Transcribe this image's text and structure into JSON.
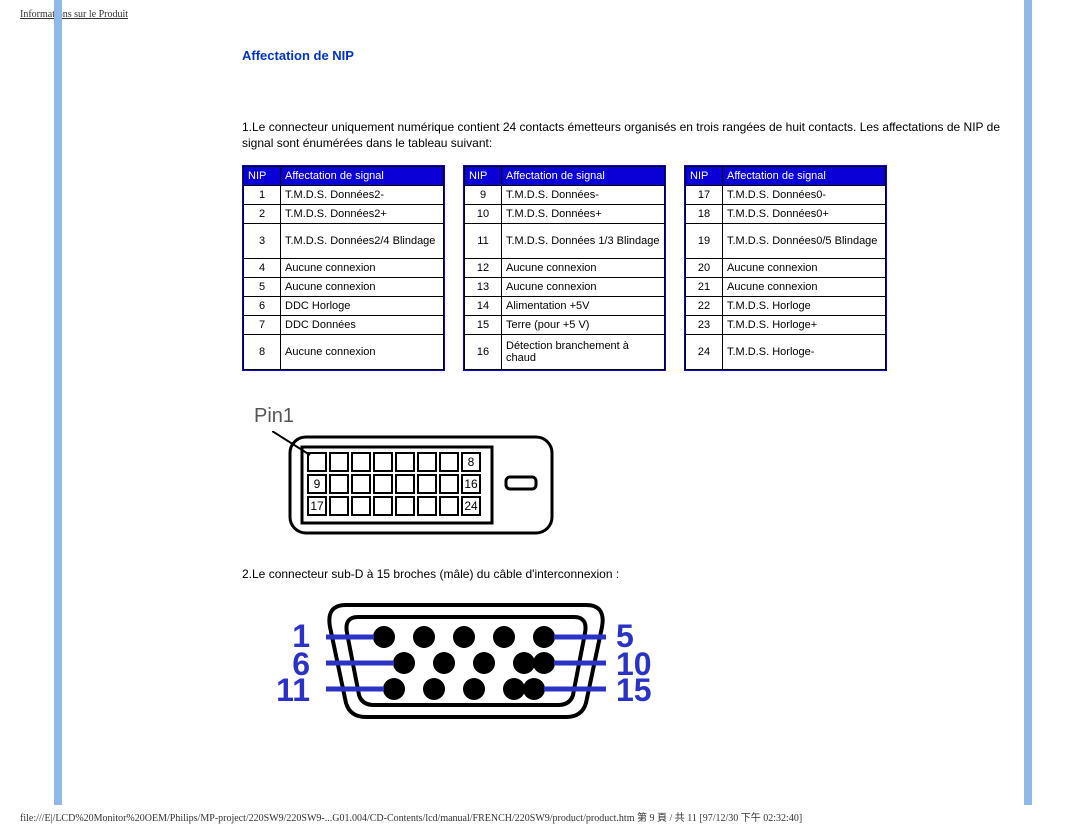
{
  "header": {
    "title": "Informations sur le Produit"
  },
  "section": {
    "title": "Affectation de NIP",
    "para1": "1.Le connecteur uniquement numérique contient 24 contacts émetteurs organisés en trois rangées de huit contacts. Les affectations de NIP de signal sont énumérées dans le tableau suivant:",
    "para2": "2.Le connecteur sub-D à 15 broches (mâle) du câble d'interconnexion :"
  },
  "table_headers": {
    "nip": "NIP",
    "sig": "Affectation de signal"
  },
  "pins_a": [
    {
      "n": "1",
      "s": "T.M.D.S. Données2-"
    },
    {
      "n": "2",
      "s": "T.M.D.S. Données2+"
    },
    {
      "n": "3",
      "s": "T.M.D.S. Données2/4 Blindage"
    },
    {
      "n": "4",
      "s": "Aucune connexion"
    },
    {
      "n": "5",
      "s": "Aucune connexion"
    },
    {
      "n": "6",
      "s": "DDC Horloge"
    },
    {
      "n": "7",
      "s": "DDC Données"
    },
    {
      "n": "8",
      "s": "Aucune connexion"
    }
  ],
  "pins_b": [
    {
      "n": "9",
      "s": "T.M.D.S. Données-"
    },
    {
      "n": "10",
      "s": "T.M.D.S. Données+"
    },
    {
      "n": "11",
      "s": "T.M.D.S. Données 1/3 Blindage"
    },
    {
      "n": "12",
      "s": "Aucune connexion"
    },
    {
      "n": "13",
      "s": "Aucune connexion"
    },
    {
      "n": "14",
      "s": "Alimentation +5V"
    },
    {
      "n": "15",
      "s": "Terre (pour +5 V)"
    },
    {
      "n": "16",
      "s": "Détection branchement à chaud"
    }
  ],
  "pins_c": [
    {
      "n": "17",
      "s": "T.M.D.S. Données0-"
    },
    {
      "n": "18",
      "s": "T.M.D.S. Données0+"
    },
    {
      "n": "19",
      "s": "T.M.D.S. Données0/5 Blindage"
    },
    {
      "n": "20",
      "s": "Aucune connexion"
    },
    {
      "n": "21",
      "s": "Aucune connexion"
    },
    {
      "n": "22",
      "s": "T.M.D.S. Horloge"
    },
    {
      "n": "23",
      "s": "T.M.D.S. Horloge+"
    },
    {
      "n": "24",
      "s": "T.M.D.S. Horloge-"
    }
  ],
  "dvi": {
    "pin1_label": "Pin1",
    "labels": {
      "r1_end": "8",
      "r2_start": "9",
      "r2_end": "16",
      "r3_start": "17",
      "r3_end": "24"
    }
  },
  "vga": {
    "r1_start": "1",
    "r1_end": "5",
    "r2_start": "6",
    "r2_end": "10",
    "r3_start": "11",
    "r3_end": "15"
  },
  "footer": {
    "path": "file:///E|/LCD%20Monitor%20OEM/Philips/MP-project/220SW9/220SW9-...G01.004/CD-Contents/lcd/manual/FRENCH/220SW9/product/product.htm 第 9 頁 / 共 11  [97/12/30 下午 02:32:40]"
  }
}
